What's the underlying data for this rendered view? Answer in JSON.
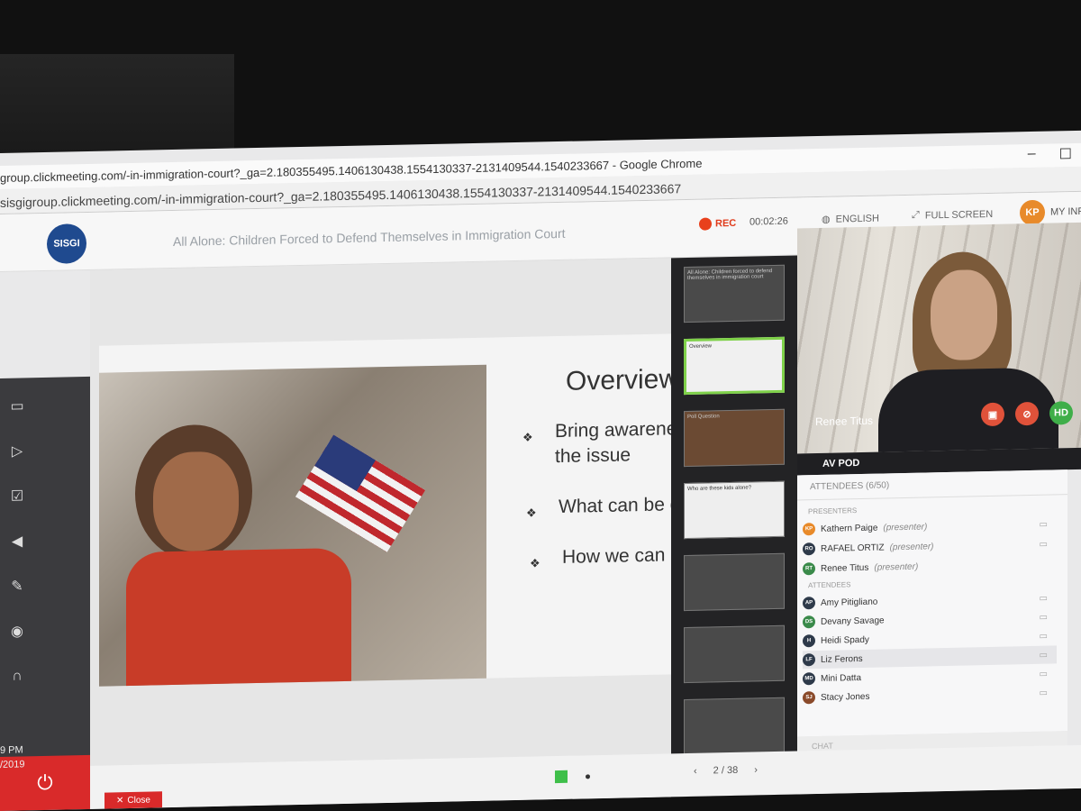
{
  "window": {
    "title": "group.clickmeeting.com/-in-immigration-court?_ga=2.180355495.1406130438.1554130337-2131409544.1540233667 - Google Chrome",
    "url": "sisgigroup.clickmeeting.com/-in-immigration-court?_ga=2.180355495.1406130438.1554130337-2131409544.1540233667"
  },
  "header": {
    "logo_text": "SISGI",
    "event_title": "All Alone: Children Forced to Defend Themselves in Immigration Court",
    "rec_label": "REC",
    "timer": "00:02:26",
    "language": "ENGLISH",
    "fullscreen": "FULL SCREEN",
    "user_initials": "KP",
    "my_info": "MY INF"
  },
  "slide": {
    "title": "Overview",
    "bullets": [
      "Bring awareness to the issue",
      "What can be done",
      "How we can help"
    ]
  },
  "thumbnails": [
    {
      "text": "All Alone: Children forced to defend themselves in immigration court"
    },
    {
      "text": "Overview"
    },
    {
      "text": "Poll Question"
    },
    {
      "text": "Who are these kids alone?"
    },
    {
      "text": ""
    },
    {
      "text": ""
    },
    {
      "text": ""
    }
  ],
  "video": {
    "presenter_name": "Renee Titus",
    "hd_label": "HD"
  },
  "avpod": {
    "label": "AV POD",
    "attendees_header": "ATTENDEES (6/50)",
    "presenters_label": "PRESENTERS",
    "attendees_label": "ATTENDEES",
    "presenters": [
      {
        "initials": "KP",
        "name": "Kathern Paige",
        "role": "(presenter)",
        "color": "#e88a2a"
      },
      {
        "initials": "RO",
        "name": "RAFAEL ORTIZ",
        "role": "(presenter)",
        "color": "#2e3a4a"
      },
      {
        "initials": "RT",
        "name": "Renee Titus",
        "role": "(presenter)",
        "color": "#3a8a4a"
      }
    ],
    "attendees": [
      {
        "initials": "AP",
        "name": "Amy Pitigliano",
        "color": "#2e3a4a"
      },
      {
        "initials": "DS",
        "name": "Devany Savage",
        "color": "#3a8a4a"
      },
      {
        "initials": "H",
        "name": "Heidi Spady",
        "color": "#2e3a4a"
      },
      {
        "initials": "LF",
        "name": "Liz Ferons",
        "color": "#2e3a4a"
      },
      {
        "initials": "MD",
        "name": "Mini Datta",
        "color": "#2e3a4a"
      },
      {
        "initials": "SJ",
        "name": "Stacy Jones",
        "color": "#8a4a2a"
      }
    ],
    "chat_label": "CHAT"
  },
  "bottom": {
    "page_indicator": "2 / 38",
    "close_label": "Close"
  },
  "clock": {
    "time": "9 PM",
    "date": "/2019"
  }
}
